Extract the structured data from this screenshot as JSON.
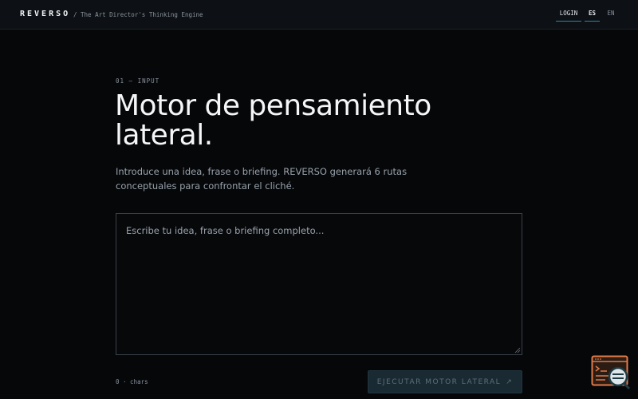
{
  "header": {
    "brand": "REVERSO",
    "tagline": "/ The Art Director's Thinking Engine",
    "login_label": "LOGIN",
    "lang_es": "ES",
    "lang_en": "EN"
  },
  "main": {
    "step_label": "01 — INPUT",
    "headline_line1": "Motor de pensamiento",
    "headline_line2": "lateral.",
    "intro": "Introduce una idea, frase o briefing. REVERSO generará 6 rutas conceptuales para confrontar el cliché.",
    "input": {
      "placeholder": "Escribe tu idea, frase o briefing completo...",
      "value": ""
    },
    "char_count": "0 · chars",
    "run_button_label": "EJECUTAR MOTOR LATERAL",
    "run_button_arrow": "↗"
  },
  "icons": {
    "widget": "assistant-widget-icon",
    "resize": "resize-handle-icon"
  },
  "colors": {
    "background": "#060709",
    "accent": "#2a8aa0",
    "widget_orange": "#e07a4a"
  }
}
